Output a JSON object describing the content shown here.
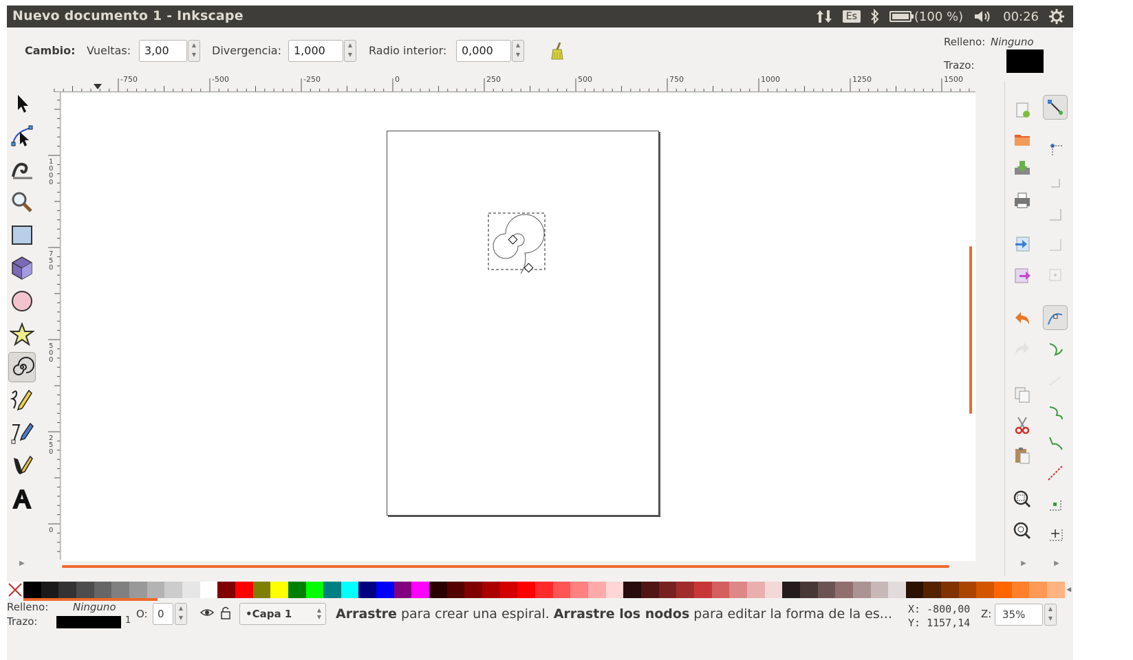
{
  "window": {
    "title": "Nuevo documento 1 - Inkscape"
  },
  "tray": {
    "keyboard_layout": "Es",
    "battery": "(100 %)",
    "battery_level_percent": 100,
    "clock": "00:26",
    "icons": [
      "network-updown-icon",
      "bluetooth-icon",
      "battery-icon",
      "volume-icon",
      "gear-icon"
    ]
  },
  "tool_controls": {
    "mode_label": "Cambio:",
    "turns_label": "Vueltas:",
    "turns_value": "3,00",
    "divergence_label": "Divergencia:",
    "divergence_value": "1,000",
    "inner_radius_label": "Radio interior:",
    "inner_radius_value": "0,000",
    "reset_icon": "broom-icon"
  },
  "style_indicator": {
    "fill_label": "Relleno:",
    "fill_value": "Ninguno",
    "stroke_label": "Trazo:",
    "stroke_width": "1",
    "stroke_color": "#000000"
  },
  "ruler": {
    "h_labels": [
      "-750",
      "-500",
      "-250",
      "0",
      "250",
      "500",
      "750",
      "1000",
      "1250",
      "1500"
    ],
    "v_labels": [
      "1000",
      "750",
      "500",
      "250",
      "0"
    ]
  },
  "toolbox": [
    {
      "name": "selector-tool",
      "icon": "arrow-pointer-icon"
    },
    {
      "name": "node-tool",
      "icon": "node-edit-icon"
    },
    {
      "name": "tweak-tool",
      "icon": "wave-icon"
    },
    {
      "name": "zoom-tool",
      "icon": "magnifier-icon"
    },
    {
      "name": "rectangle-tool",
      "icon": "rectangle-icon"
    },
    {
      "name": "3d-box-tool",
      "icon": "cube-icon"
    },
    {
      "name": "ellipse-tool",
      "icon": "circle-icon"
    },
    {
      "name": "star-tool",
      "icon": "star-icon"
    },
    {
      "name": "spiral-tool",
      "icon": "spiral-icon",
      "active": true
    },
    {
      "name": "pencil-tool",
      "icon": "pencil-icon"
    },
    {
      "name": "pen-tool",
      "icon": "pen-icon"
    },
    {
      "name": "calligraphy-tool",
      "icon": "calligraphy-icon"
    },
    {
      "name": "text-tool",
      "icon": "text-A-icon"
    }
  ],
  "commands": [
    {
      "name": "new-document",
      "icon": "new-document-icon"
    },
    {
      "name": "open-document",
      "icon": "open-folder-icon"
    },
    {
      "name": "save-document",
      "icon": "save-icon"
    },
    {
      "name": "print-document",
      "icon": "printer-icon"
    },
    {
      "name": "import",
      "icon": "import-icon"
    },
    {
      "name": "export",
      "icon": "export-icon"
    },
    {
      "name": "undo",
      "icon": "undo-icon"
    },
    {
      "name": "redo",
      "icon": "redo-icon"
    },
    {
      "name": "copy",
      "icon": "copy-icon"
    },
    {
      "name": "cut",
      "icon": "scissors-icon"
    },
    {
      "name": "paste",
      "icon": "paste-icon"
    },
    {
      "name": "zoom-selection",
      "icon": "zoom-selection-icon"
    },
    {
      "name": "zoom-drawing",
      "icon": "zoom-drawing-icon"
    }
  ],
  "snap_controls": [
    {
      "name": "snap-toggle",
      "icon": "snap-magnet-icon",
      "active": true
    },
    {
      "name": "snap-bbox",
      "icon": "snap-bbox-icon"
    },
    {
      "name": "snap-bbox-edges",
      "icon": "snap-edges-icon"
    },
    {
      "name": "snap-bbox-corners",
      "icon": "snap-corners-icon"
    },
    {
      "name": "snap-bbox-midpoints",
      "icon": "snap-midpoints-icon"
    },
    {
      "name": "snap-bbox-centers",
      "icon": "snap-centers-icon"
    },
    {
      "name": "snap-nodes",
      "icon": "snap-nodes-icon",
      "active": true
    },
    {
      "name": "snap-paths",
      "icon": "snap-paths-icon"
    },
    {
      "name": "snap-intersections",
      "icon": "snap-intersections-icon"
    },
    {
      "name": "snap-cusp-nodes",
      "icon": "snap-cusp-icon"
    },
    {
      "name": "snap-smooth-nodes",
      "icon": "snap-smooth-icon"
    },
    {
      "name": "snap-midpoints",
      "icon": "snap-line-midpoints-icon"
    },
    {
      "name": "snap-object-centers",
      "icon": "snap-object-centers-icon"
    },
    {
      "name": "snap-page-border",
      "icon": "snap-page-icon"
    }
  ],
  "palette": {
    "colors": [
      "#000000",
      "#1a1a1a",
      "#333333",
      "#4d4d4d",
      "#666666",
      "#808080",
      "#999999",
      "#b3b3b3",
      "#cccccc",
      "#e6e6e6",
      "#ffffff",
      "#800000",
      "#ff0000",
      "#808000",
      "#ffff00",
      "#008000",
      "#00ff00",
      "#008080",
      "#00ffff",
      "#000080",
      "#0000ff",
      "#800080",
      "#ff00ff",
      "#2b0000",
      "#550000",
      "#800000",
      "#aa0000",
      "#d40000",
      "#ff0000",
      "#ff2a2a",
      "#ff5555",
      "#ff8080",
      "#ffaaaa",
      "#ffd5d5",
      "#280b0b",
      "#501616",
      "#782121",
      "#a02c2c",
      "#c83737",
      "#d35f5f",
      "#de8787",
      "#e9afaf",
      "#f4d7d7",
      "#241c1c",
      "#483737",
      "#6c5353",
      "#916f6f",
      "#ac9393",
      "#c8b7b7",
      "#e3dbdb",
      "#2b1100",
      "#552200",
      "#803300",
      "#aa4400",
      "#d45500",
      "#ff6600",
      "#ff7f2a",
      "#ff9955",
      "#ffb380"
    ]
  },
  "status": {
    "fill_label": "Relleno:",
    "fill_value": "Ninguno",
    "stroke_label": "Trazo:",
    "stroke_width": "1",
    "opacity_label": "O:",
    "opacity_value": "0",
    "layer": "•Capa 1",
    "message_bold_1": "Arrastre",
    "message_text_1": " para crear una espiral. ",
    "message_bold_2": "Arrastre los nodos",
    "message_text_2": " para editar la forma de la es...",
    "x_coord": "X: -800,00",
    "y_coord": "Y: 1157,14",
    "zoom_label": "Z:",
    "zoom_value": "35%"
  }
}
